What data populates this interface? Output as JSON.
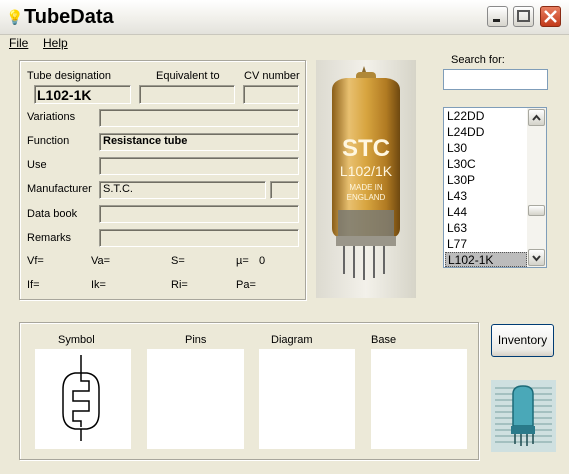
{
  "window": {
    "title": "TubeData"
  },
  "menu": {
    "items": [
      {
        "label": "File",
        "key": "F"
      },
      {
        "label": "Help",
        "key": "H"
      }
    ]
  },
  "labels": {
    "tube_designation": "Tube designation",
    "equivalent_to": "Equivalent to",
    "cv_number": "CV number",
    "variations": "Variations",
    "function": "Function",
    "use": "Use",
    "manufacturer": "Manufacturer",
    "data_book": "Data book",
    "remarks": "Remarks"
  },
  "fields": {
    "tube_designation": "L102-1K",
    "equivalent_to": "",
    "cv_number": "",
    "variations": "",
    "function": "Resistance tube",
    "use": "",
    "manufacturer": "S.T.C.",
    "manufacturer_extra": "",
    "data_book": "",
    "remarks": ""
  },
  "params": {
    "vf": "Vf=",
    "va": "Va=",
    "s": "S=",
    "mu": "µ=",
    "mu_value": "0",
    "if": "If=",
    "ik": "Ik=",
    "ri": "Ri=",
    "pa": "Pa="
  },
  "photo": {
    "brand": "STC",
    "model": "L102/1K",
    "line1": "MADE IN",
    "line2": "ENGLAND"
  },
  "search": {
    "label": "Search for:",
    "value": ""
  },
  "tube_list": {
    "items": [
      "L22DD",
      "L24DD",
      "L30",
      "L30C",
      "L30P",
      "L43",
      "L44",
      "L63",
      "L77",
      "L102-1K"
    ],
    "selected": "L102-1K"
  },
  "bottom": {
    "symbol": "Symbol",
    "pins": "Pins",
    "diagram": "Diagram",
    "base": "Base"
  },
  "inventory_button": "Inventory",
  "colors": {
    "selection": "#bcbcbc",
    "close_button": "#c23a1a",
    "tube_amber": "#c89a3a"
  }
}
